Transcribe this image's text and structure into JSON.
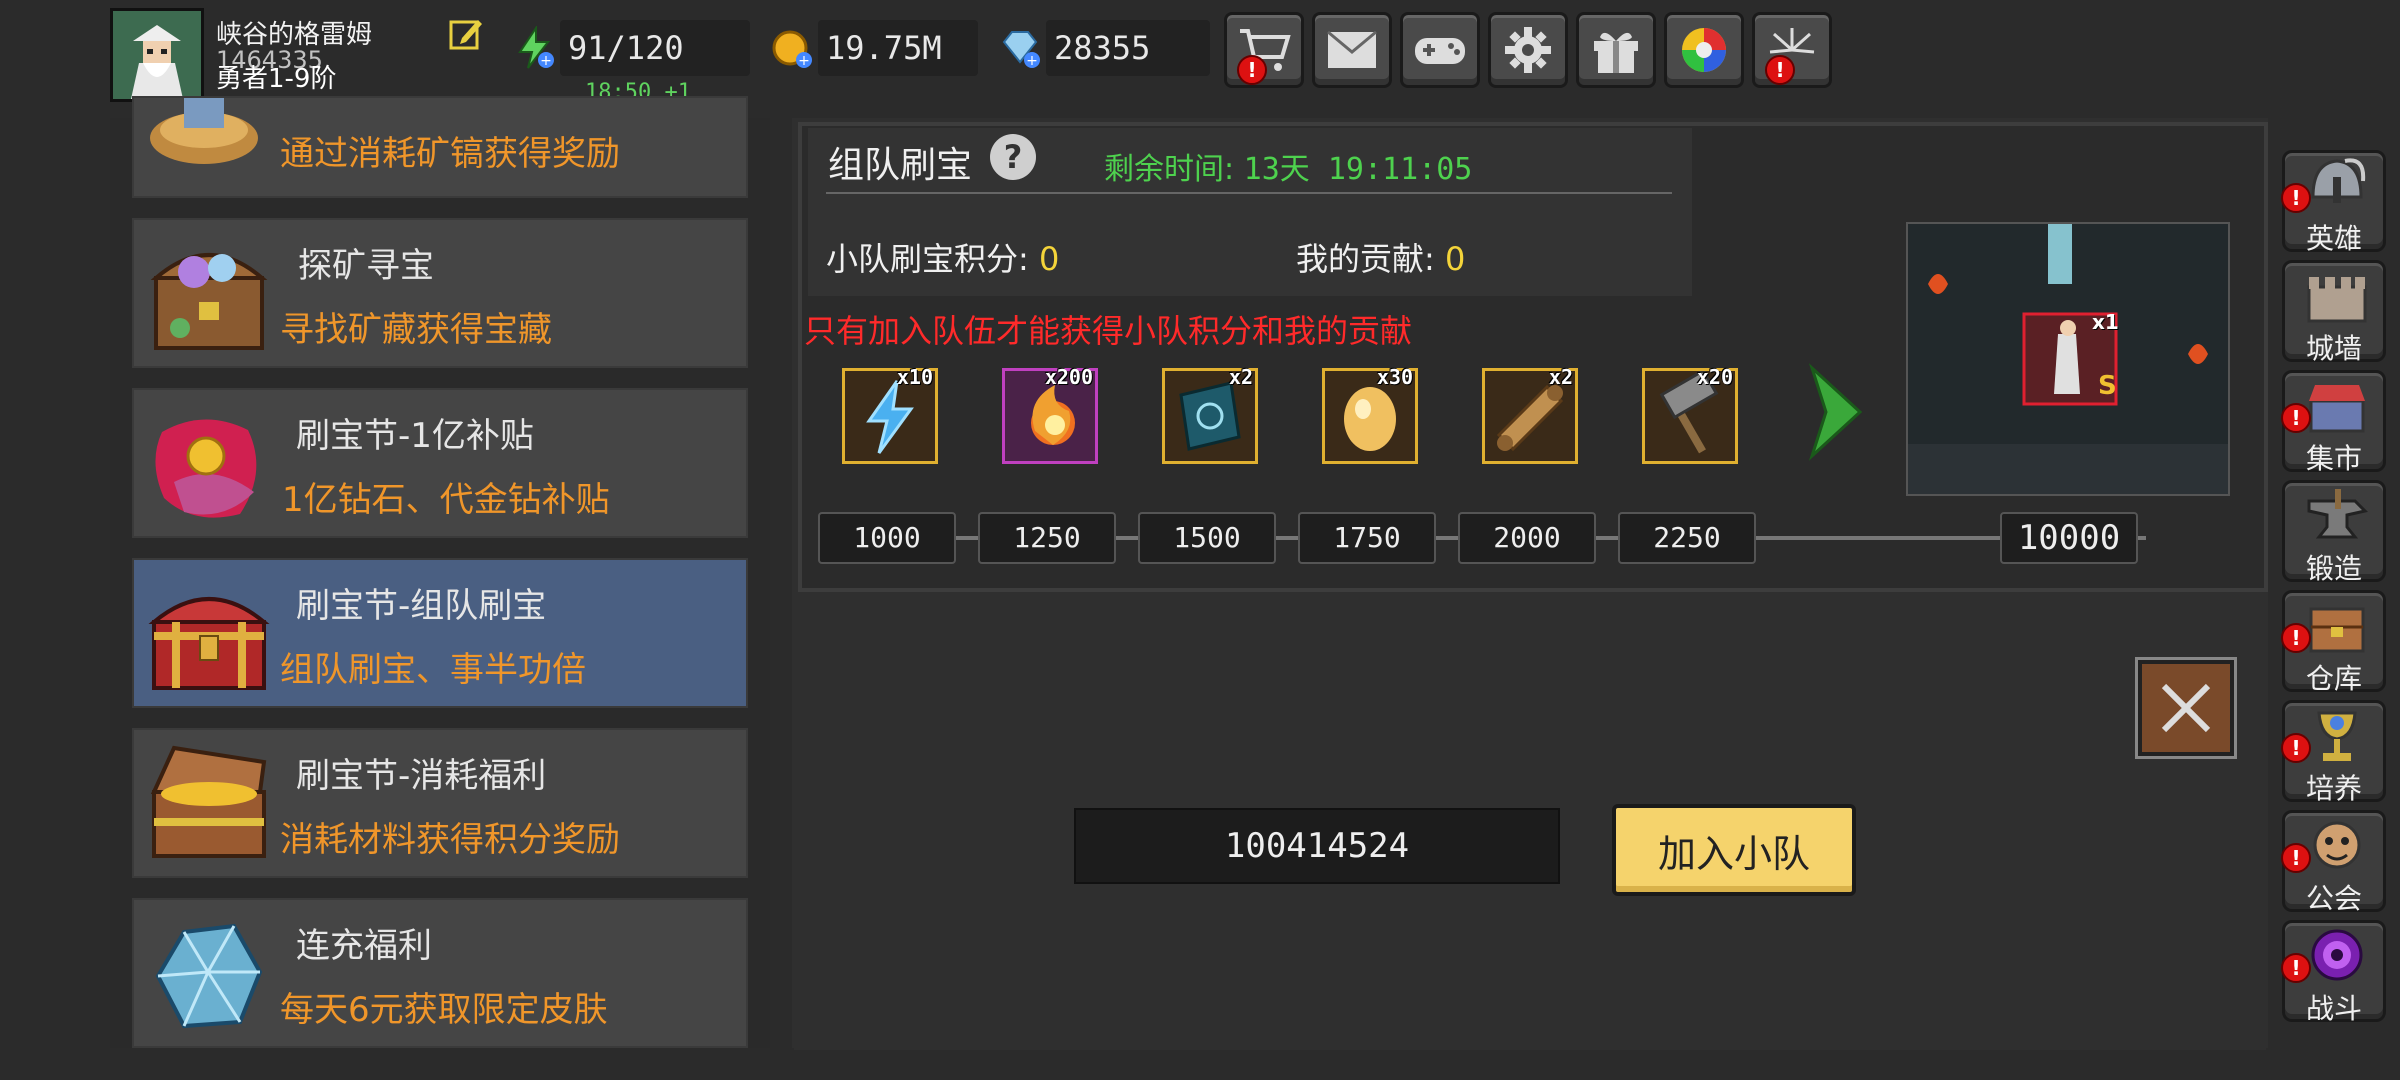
{
  "player": {
    "name": "峡谷的格雷姆",
    "id": "1464335",
    "rank": "勇者1-9阶"
  },
  "resources": {
    "stamina": "91/120",
    "stamina_regen": "18:50 +1",
    "gold": "19.75M",
    "diamonds": "28355"
  },
  "top_buttons": [
    {
      "icon": "cart-icon",
      "alert": true
    },
    {
      "icon": "mail-icon",
      "alert": false
    },
    {
      "icon": "gamepad-icon",
      "alert": false
    },
    {
      "icon": "gear-icon",
      "alert": false
    },
    {
      "icon": "gift-icon",
      "alert": false
    },
    {
      "icon": "color-wheel-icon",
      "alert": false
    },
    {
      "icon": "fireworks-icon",
      "alert": true
    }
  ],
  "menu": {
    "items": [
      {
        "title": "",
        "subtitle": "通过消耗矿镐获得奖励",
        "icon": "mining-icon"
      },
      {
        "title": "探矿寻宝",
        "subtitle": "寻找矿藏获得宝藏",
        "icon": "treasure-chest-icon"
      },
      {
        "title": "刷宝节-1亿补贴",
        "subtitle": "1亿钻石、代金钻补贴",
        "icon": "red-envelope-icon"
      },
      {
        "title": "刷宝节-组队刷宝",
        "subtitle": "组队刷宝、事半功倍",
        "icon": "red-chest-icon",
        "active": true
      },
      {
        "title": "刷宝节-消耗福利",
        "subtitle": "消耗材料获得积分奖励",
        "icon": "open-chest-icon"
      },
      {
        "title": "连充福利",
        "subtitle": "每天6元获取限定皮肤",
        "icon": "crystal-icon"
      }
    ]
  },
  "event": {
    "title": "组队刷宝",
    "remaining_label": "剩余时间:",
    "remaining_value": "13天 19:11:05",
    "team_score_label": "小队刷宝积分:",
    "team_score": "0",
    "my_contrib_label": "我的贡献:",
    "my_contrib": "0",
    "notice": "只有加入队伍才能获得小队积分和我的贡献",
    "rewards": [
      {
        "qty": "x10",
        "icon": "lightning-icon"
      },
      {
        "qty": "x200",
        "icon": "fire-orb-icon"
      },
      {
        "qty": "x2",
        "icon": "spellbook-icon"
      },
      {
        "qty": "x30",
        "icon": "egg-icon"
      },
      {
        "qty": "x2",
        "icon": "scroll-icon"
      },
      {
        "qty": "x20",
        "icon": "hammer-icon"
      }
    ],
    "milestones": [
      "1000",
      "1250",
      "1500",
      "1750",
      "2000",
      "2250",
      "10000"
    ],
    "final_reward_qty": "x1"
  },
  "team": {
    "input_value": "100414524",
    "join_label": "加入小队"
  },
  "right_nav": [
    {
      "label": "英雄",
      "icon": "helmet-icon",
      "alert": true
    },
    {
      "label": "城墙",
      "icon": "castle-wall-icon",
      "alert": false
    },
    {
      "label": "集市",
      "icon": "market-icon",
      "alert": true
    },
    {
      "label": "锻造",
      "icon": "anvil-icon",
      "alert": false
    },
    {
      "label": "仓库",
      "icon": "warehouse-icon",
      "alert": true
    },
    {
      "label": "培养",
      "icon": "goblet-icon",
      "alert": true
    },
    {
      "label": "公会",
      "icon": "guild-icon",
      "alert": true
    },
    {
      "label": "战斗",
      "icon": "portal-icon",
      "alert": true
    }
  ],
  "colors": {
    "accent_green": "#4ed24e",
    "subtitle_orange": "#f0962a",
    "notice_red": "#ff2a2a",
    "score_yellow": "#f4d43a",
    "active_blue": "#4a5f82",
    "join_yellow": "#f5d36c"
  }
}
